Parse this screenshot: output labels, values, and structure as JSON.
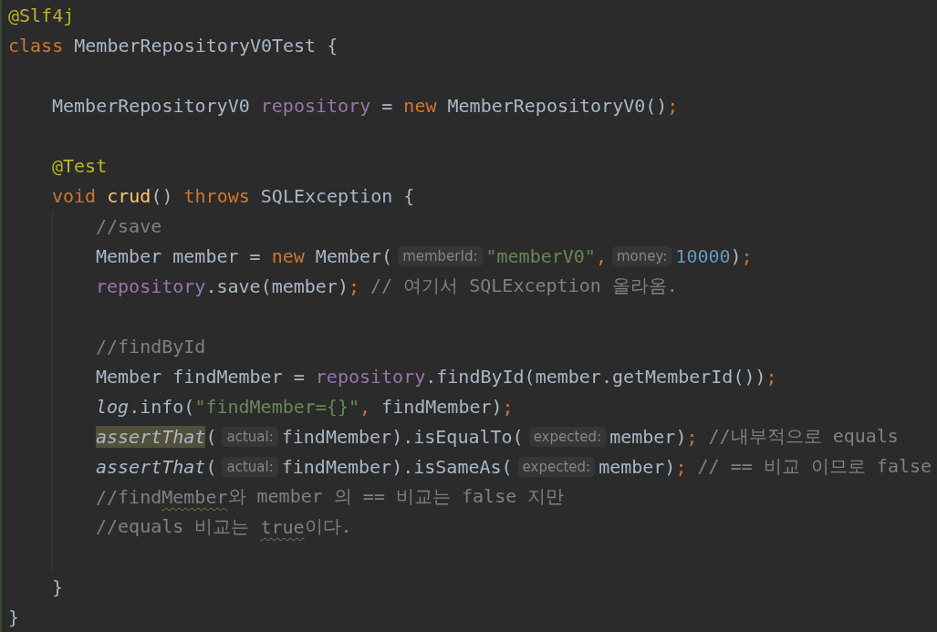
{
  "lines": [
    {
      "kind": "code",
      "tokens": [
        {
          "kind": "annotation",
          "text": "@Slf4j"
        }
      ]
    },
    {
      "kind": "code",
      "tokens": [
        {
          "kind": "keyword",
          "text": "class"
        },
        {
          "kind": "plain",
          "text": " MemberRepositoryV0Test {"
        }
      ],
      "children": [
        {
          "kind": "blank"
        },
        {
          "kind": "code",
          "tokens": [
            {
              "kind": "plain",
              "text": "MemberRepositoryV0"
            },
            {
              "kind": "field",
              "text": " repository"
            },
            {
              "kind": "plain",
              "text": " ="
            },
            {
              "kind": "keyword",
              "text": " new"
            },
            {
              "kind": "plain",
              "text": " MemberRepositoryV0()"
            },
            {
              "kind": "punct",
              "text": ";"
            }
          ]
        },
        {
          "kind": "blank"
        },
        {
          "kind": "code",
          "tokens": [
            {
              "kind": "annotation",
              "text": "@Test"
            }
          ]
        },
        {
          "kind": "code",
          "tokens": [
            {
              "kind": "keyword",
              "text": "void"
            },
            {
              "kind": "method",
              "text": " crud"
            },
            {
              "kind": "plain",
              "text": "()"
            },
            {
              "kind": "keyword",
              "text": " throws"
            },
            {
              "kind": "plain",
              "text": " SQLException {"
            }
          ],
          "children": [
            {
              "kind": "code",
              "tokens": [
                {
                  "kind": "comment",
                  "text": "//save"
                }
              ]
            },
            {
              "kind": "code",
              "tokens": [
                {
                  "kind": "plain",
                  "text": "Member member ="
                },
                {
                  "kind": "keyword",
                  "text": " new"
                },
                {
                  "kind": "plain",
                  "text": " Member("
                },
                {
                  "kind": "hint",
                  "text": "memberId:"
                },
                {
                  "kind": "string",
                  "text": "\"memberV0\""
                },
                {
                  "kind": "punct",
                  "text": ","
                },
                {
                  "kind": "hint",
                  "text": "money:"
                },
                {
                  "kind": "number",
                  "text": "10000"
                },
                {
                  "kind": "plain",
                  "text": ")"
                },
                {
                  "kind": "punct",
                  "text": ";"
                }
              ]
            },
            {
              "kind": "code",
              "tokens": [
                {
                  "kind": "field",
                  "text": "repository"
                },
                {
                  "kind": "plain",
                  "text": ".save(member)"
                },
                {
                  "kind": "punct",
                  "text": ";"
                },
                {
                  "kind": "comment",
                  "text": " // 여기서 SQLException 올라옴."
                }
              ]
            },
            {
              "kind": "blank"
            },
            {
              "kind": "code",
              "tokens": [
                {
                  "kind": "comment",
                  "text": "//findById"
                }
              ]
            },
            {
              "kind": "code",
              "tokens": [
                {
                  "kind": "plain",
                  "text": "Member findMember ="
                },
                {
                  "kind": "field",
                  "text": " repository"
                },
                {
                  "kind": "plain",
                  "text": ".findById(member.getMemberId())"
                },
                {
                  "kind": "punct",
                  "text": ";"
                }
              ]
            },
            {
              "kind": "code",
              "tokens": [
                {
                  "kind": "static",
                  "text": "log"
                },
                {
                  "kind": "plain",
                  "text": ".info("
                },
                {
                  "kind": "string",
                  "text": "\"findMember={}\""
                },
                {
                  "kind": "punct",
                  "text": ","
                },
                {
                  "kind": "plain",
                  "text": " findMember)"
                },
                {
                  "kind": "punct",
                  "text": ";"
                }
              ]
            },
            {
              "kind": "code",
              "tokens": [
                {
                  "kind": "static",
                  "text": "assertThat",
                  "highlighted": true
                },
                {
                  "kind": "plain",
                  "text": "("
                },
                {
                  "kind": "hint",
                  "text": "actual:"
                },
                {
                  "kind": "plain",
                  "text": "findMember).isEqualTo("
                },
                {
                  "kind": "hint",
                  "text": "expected:"
                },
                {
                  "kind": "plain",
                  "text": "member)"
                },
                {
                  "kind": "punct",
                  "text": ";"
                },
                {
                  "kind": "comment",
                  "text": " //내부적으로 equals"
                }
              ]
            },
            {
              "kind": "code",
              "tokens": [
                {
                  "kind": "static",
                  "text": "assertThat",
                  "highlighted": false
                },
                {
                  "kind": "plain",
                  "text": "("
                },
                {
                  "kind": "hint",
                  "text": "actual:"
                },
                {
                  "kind": "plain",
                  "text": "findMember).isSameAs("
                },
                {
                  "kind": "hint",
                  "text": "expected:"
                },
                {
                  "kind": "plain",
                  "text": "member)"
                },
                {
                  "kind": "punct",
                  "text": ";"
                },
                {
                  "kind": "comment",
                  "text": " // == 비교 이므로 false"
                }
              ]
            },
            {
              "kind": "code",
              "tokens": [
                {
                  "kind": "comment",
                  "text": "//find"
                },
                {
                  "kind": "comment",
                  "text": "Member",
                  "typo": true
                },
                {
                  "kind": "comment",
                  "text": "와 member 의 == 비교는 false 지만"
                }
              ]
            },
            {
              "kind": "code",
              "tokens": [
                {
                  "kind": "comment",
                  "text": "//equals 비교는 "
                },
                {
                  "kind": "comment",
                  "text": "true",
                  "typo": true
                },
                {
                  "kind": "comment",
                  "text": "이다."
                }
              ]
            },
            {
              "kind": "blank"
            }
          ]
        },
        {
          "kind": "code",
          "tokens": [
            {
              "kind": "plain",
              "text": "}"
            }
          ]
        }
      ]
    },
    {
      "kind": "code",
      "tokens": [
        {
          "kind": "plain",
          "text": "}"
        }
      ]
    }
  ]
}
